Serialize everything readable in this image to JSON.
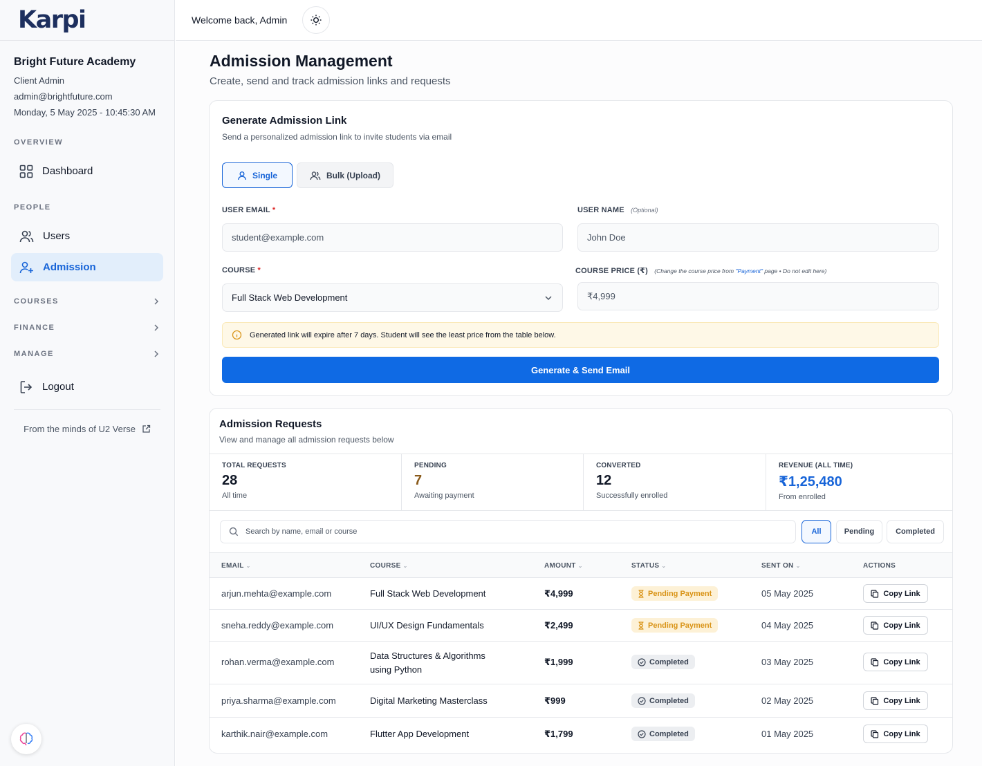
{
  "app": {
    "logo_text": "Karpi"
  },
  "org": {
    "name": "Bright Future Academy",
    "role": "Client Admin",
    "email": "admin@brightfuture.com",
    "datetime": "Monday, 5 May 2025 - 10:45:30 AM"
  },
  "sidebar": {
    "overview_label": "OVERVIEW",
    "dashboard": "Dashboard",
    "people_label": "PEOPLE",
    "users": "Users",
    "admission": "Admission",
    "courses": "COURSES",
    "finance": "FINANCE",
    "manage": "MANAGE",
    "logout": "Logout",
    "footer": "From the minds of U2 Verse"
  },
  "topbar": {
    "welcome": "Welcome back, Admin"
  },
  "page": {
    "title": "Admission Management",
    "subtitle": "Create, send and track admission links and requests"
  },
  "generate": {
    "title": "Generate Admission Link",
    "subtitle": "Send a personalized admission link to invite students via email",
    "mode_single": "Single",
    "mode_bulk": "Bulk (Upload)",
    "email_label": "USER EMAIL",
    "email_placeholder": "student@example.com",
    "name_label": "USER NAME",
    "name_optional": "(Optional)",
    "name_placeholder": "John Doe",
    "course_label": "COURSE",
    "course_value": "Full Stack Web Development",
    "price_label": "COURSE PRICE (₹)",
    "price_note_prefix": "(Change the course price from ",
    "price_note_link": "\"Payment\"",
    "price_note_suffix": " page   •  Do not edit here)",
    "price_value": "₹4,999",
    "notice": "Generated link will expire after 7 days. Student will see the least price from the table below.",
    "button": "Generate & Send Email",
    "required_mark": "*"
  },
  "requests": {
    "title": "Admission Requests",
    "subtitle": "View and manage all admission requests below",
    "stats": [
      {
        "label": "TOTAL REQUESTS",
        "value": "28",
        "caption": "All time"
      },
      {
        "label": "PENDING",
        "value": "7",
        "caption": "Awaiting payment"
      },
      {
        "label": "CONVERTED",
        "value": "12",
        "caption": "Successfully enrolled"
      },
      {
        "label": "REVENUE (ALL TIME)",
        "value": "₹1,25,480",
        "caption": "From enrolled"
      }
    ],
    "search_placeholder": "Search by name, email or course",
    "filters": [
      "All",
      "Pending",
      "Completed"
    ],
    "columns": [
      "EMAIL",
      "COURSE",
      "AMOUNT",
      "STATUS",
      "SENT ON",
      "ACTIONS"
    ],
    "copy_label": "Copy Link",
    "rows": [
      {
        "email": "arjun.mehta@example.com",
        "course": "Full Stack Web Development",
        "amount": "₹4,999",
        "status": "Pending Payment",
        "status_type": "pending",
        "sent": "05 May 2025"
      },
      {
        "email": "sneha.reddy@example.com",
        "course": "UI/UX Design Fundamentals",
        "amount": "₹2,499",
        "status": "Pending Payment",
        "status_type": "pending",
        "sent": "04 May 2025"
      },
      {
        "email": "rohan.verma@example.com",
        "course": "Data Structures & Algorithms using Python",
        "amount": "₹1,999",
        "status": "Completed",
        "status_type": "done",
        "sent": "03 May 2025"
      },
      {
        "email": "priya.sharma@example.com",
        "course": "Digital Marketing Masterclass",
        "amount": "₹999",
        "status": "Completed",
        "status_type": "done",
        "sent": "02 May 2025"
      },
      {
        "email": "karthik.nair@example.com",
        "course": "Flutter App Development",
        "amount": "₹1,799",
        "status": "Completed",
        "status_type": "done",
        "sent": "01 May 2025"
      }
    ]
  },
  "colors": {
    "accent": "#1764d8",
    "button": "#0f6ae4",
    "pending_text": "#d99418",
    "pending_bg": "#fdf1d6",
    "notice_bg": "#fef8e7"
  },
  "icons": {
    "dashboard": "grid-icon",
    "users": "users-icon",
    "admission": "user-plus-icon",
    "logout": "logout-icon",
    "external": "external-link-icon",
    "theme": "sun-icon",
    "help": "brain-icon",
    "info": "info-icon",
    "search": "search-icon",
    "hourglass": "hourglass-icon",
    "check": "check-circle-icon",
    "copy": "copy-icon"
  }
}
